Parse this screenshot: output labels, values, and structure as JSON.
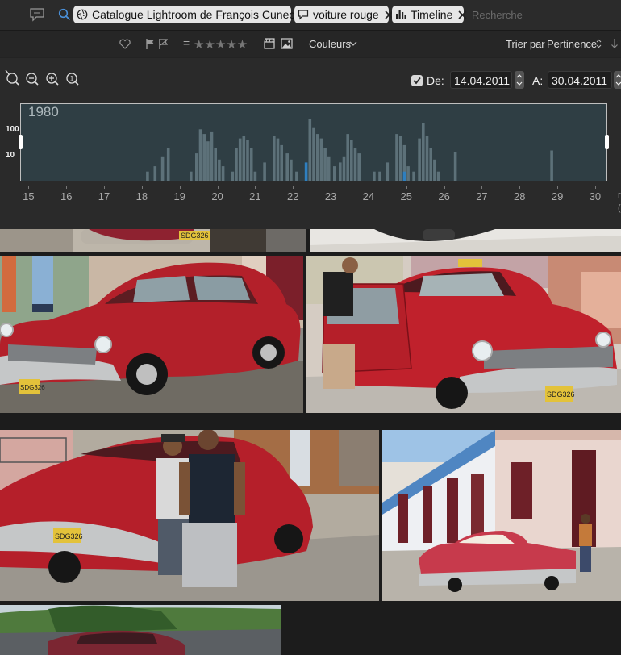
{
  "search": {
    "tokens": [
      {
        "type": "catalog",
        "label": "Catalogue Lightroom de François Cuneo"
      },
      {
        "type": "text",
        "label": "voiture rouge"
      },
      {
        "type": "timeline",
        "label": "Timeline"
      }
    ],
    "placeholder": "Recherche"
  },
  "filters": {
    "rating_equals": "=",
    "stars": "★★★★★",
    "colors_label": "Couleurs",
    "sort_label": "Trier par",
    "sort_value": "Pertinence"
  },
  "timeline": {
    "from_label": "De:",
    "from_date": "14.04.2011",
    "to_label": "A:",
    "to_date": "30.04.2011",
    "from_checked": true,
    "year": "1980",
    "edge_text_top": "r",
    "edge_text_bottom": "("
  },
  "chart_data": {
    "type": "bar",
    "title": "1980",
    "y_scale": "log",
    "y_ticks": [
      "100",
      "10"
    ],
    "x_ticks": [
      "15",
      "16",
      "17",
      "18",
      "19",
      "20",
      "21",
      "22",
      "23",
      "24",
      "25",
      "26",
      "27",
      "28",
      "29",
      "30"
    ],
    "x_range": [
      14.8,
      30.3
    ],
    "bars": [
      {
        "x": 18.15,
        "v": 2
      },
      {
        "x": 18.35,
        "v": 3
      },
      {
        "x": 18.55,
        "v": 6
      },
      {
        "x": 18.7,
        "v": 12
      },
      {
        "x": 19.3,
        "v": 2
      },
      {
        "x": 19.45,
        "v": 8
      },
      {
        "x": 19.55,
        "v": 50
      },
      {
        "x": 19.65,
        "v": 35
      },
      {
        "x": 19.75,
        "v": 20
      },
      {
        "x": 19.85,
        "v": 40
      },
      {
        "x": 19.95,
        "v": 12
      },
      {
        "x": 20.05,
        "v": 5
      },
      {
        "x": 20.15,
        "v": 3
      },
      {
        "x": 20.4,
        "v": 2
      },
      {
        "x": 20.5,
        "v": 12
      },
      {
        "x": 20.6,
        "v": 25
      },
      {
        "x": 20.7,
        "v": 30
      },
      {
        "x": 20.8,
        "v": 22
      },
      {
        "x": 20.9,
        "v": 12
      },
      {
        "x": 21.0,
        "v": 2
      },
      {
        "x": 21.25,
        "v": 4
      },
      {
        "x": 21.5,
        "v": 30
      },
      {
        "x": 21.6,
        "v": 25
      },
      {
        "x": 21.7,
        "v": 15
      },
      {
        "x": 21.85,
        "v": 8
      },
      {
        "x": 21.95,
        "v": 5
      },
      {
        "x": 22.1,
        "v": 2
      },
      {
        "x": 22.45,
        "v": 110
      },
      {
        "x": 22.55,
        "v": 55
      },
      {
        "x": 22.65,
        "v": 35
      },
      {
        "x": 22.75,
        "v": 25
      },
      {
        "x": 22.85,
        "v": 12
      },
      {
        "x": 22.95,
        "v": 6
      },
      {
        "x": 23.1,
        "v": 3
      },
      {
        "x": 23.25,
        "v": 4
      },
      {
        "x": 23.35,
        "v": 6
      },
      {
        "x": 23.45,
        "v": 35
      },
      {
        "x": 23.55,
        "v": 22
      },
      {
        "x": 23.65,
        "v": 12
      },
      {
        "x": 23.75,
        "v": 8
      },
      {
        "x": 24.15,
        "v": 2
      },
      {
        "x": 24.3,
        "v": 2
      },
      {
        "x": 24.5,
        "v": 4
      },
      {
        "x": 24.75,
        "v": 35
      },
      {
        "x": 24.85,
        "v": 30
      },
      {
        "x": 24.95,
        "v": 15
      },
      {
        "x": 25.05,
        "v": 3
      },
      {
        "x": 25.2,
        "v": 2
      },
      {
        "x": 25.35,
        "v": 25
      },
      {
        "x": 25.45,
        "v": 80
      },
      {
        "x": 25.55,
        "v": 30
      },
      {
        "x": 25.65,
        "v": 12
      },
      {
        "x": 25.75,
        "v": 5
      },
      {
        "x": 25.85,
        "v": 2
      },
      {
        "x": 26.3,
        "v": 9
      },
      {
        "x": 28.85,
        "v": 10
      }
    ],
    "highlight_bars": [
      {
        "x": 22.35,
        "v": 4
      },
      {
        "x": 24.95,
        "v": 2
      }
    ],
    "colors": {
      "bar": "#5d7179",
      "highlight": "#2f7fbf",
      "background": "#2f3e44"
    }
  },
  "photos": [
    {
      "id": "p1",
      "subject": "red-car-front-partial"
    },
    {
      "id": "p2",
      "subject": "car-shadow-partial"
    },
    {
      "id": "p3",
      "subject": "red-classic-car-side-view"
    },
    {
      "id": "p4",
      "subject": "red-taxi-door-open"
    },
    {
      "id": "p5",
      "subject": "two-men-by-red-car"
    },
    {
      "id": "p6",
      "subject": "street-with-colonial-houses"
    },
    {
      "id": "p7",
      "subject": "car-on-road-partial"
    }
  ],
  "colors": {
    "accent_blue": "#4a90d9",
    "token_bg": "#e6e6e6",
    "car_red": "#b3202a"
  }
}
